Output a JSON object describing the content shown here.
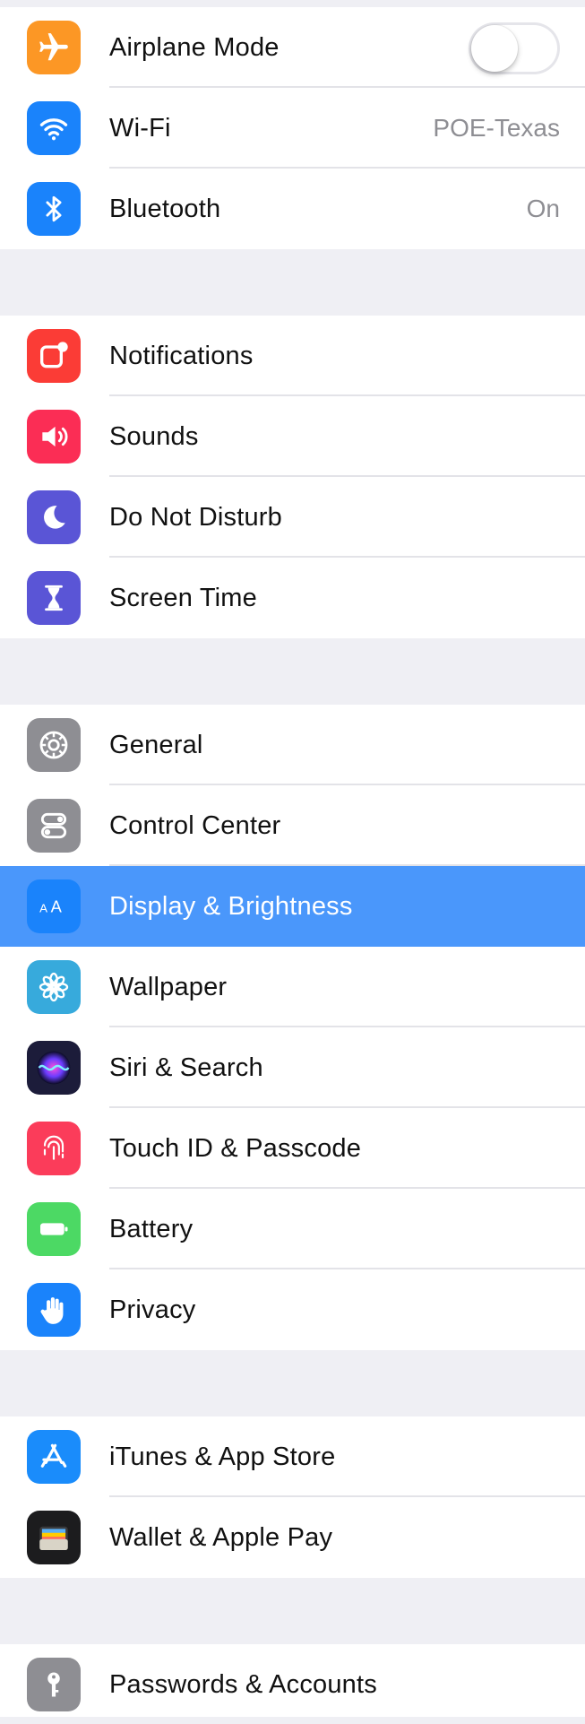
{
  "sections": [
    {
      "rows": [
        {
          "label": "Airplane Mode",
          "icon": "airplane-icon",
          "color": "#fc9725",
          "toggle": false
        },
        {
          "label": "Wi-Fi",
          "icon": "wifi-icon",
          "color": "#1a83fb",
          "value": "POE-Texas"
        },
        {
          "label": "Bluetooth",
          "icon": "bluetooth-icon",
          "color": "#1a83fb",
          "value": "On"
        }
      ]
    },
    {
      "rows": [
        {
          "label": "Notifications",
          "icon": "notifications-icon",
          "color": "#fb3c36"
        },
        {
          "label": "Sounds",
          "icon": "speaker-icon",
          "color": "#fb2d55"
        },
        {
          "label": "Do Not Disturb",
          "icon": "moon-icon",
          "color": "#5a55d6"
        },
        {
          "label": "Screen Time",
          "icon": "hourglass-icon",
          "color": "#5a55d6"
        }
      ]
    },
    {
      "rows": [
        {
          "label": "General",
          "icon": "gear-icon",
          "color": "#8e8e93"
        },
        {
          "label": "Control Center",
          "icon": "control-center-icon",
          "color": "#8e8e93"
        },
        {
          "label": "Display & Brightness",
          "icon": "display-aa-icon",
          "color": "#1a83fb",
          "selected": true
        },
        {
          "label": "Wallpaper",
          "icon": "flower-icon",
          "color": "#37aadc"
        },
        {
          "label": "Siri & Search",
          "icon": "siri-icon",
          "color": "#1c1c3a"
        },
        {
          "label": "Touch ID & Passcode",
          "icon": "fingerprint-icon",
          "color": "#fb3c5a"
        },
        {
          "label": "Battery",
          "icon": "battery-icon",
          "color": "#4cd964"
        },
        {
          "label": "Privacy",
          "icon": "hand-icon",
          "color": "#1a83fb"
        }
      ]
    },
    {
      "rows": [
        {
          "label": "iTunes & App Store",
          "icon": "app-store-icon",
          "color": "#1a8cfb"
        },
        {
          "label": "Wallet & Apple Pay",
          "icon": "wallet-icon",
          "color": "#1c1c1e"
        }
      ]
    },
    {
      "rows": [
        {
          "label": "Passwords & Accounts",
          "icon": "key-icon",
          "color": "#8e8e93"
        }
      ]
    }
  ],
  "selected_color": "#4a97fb"
}
